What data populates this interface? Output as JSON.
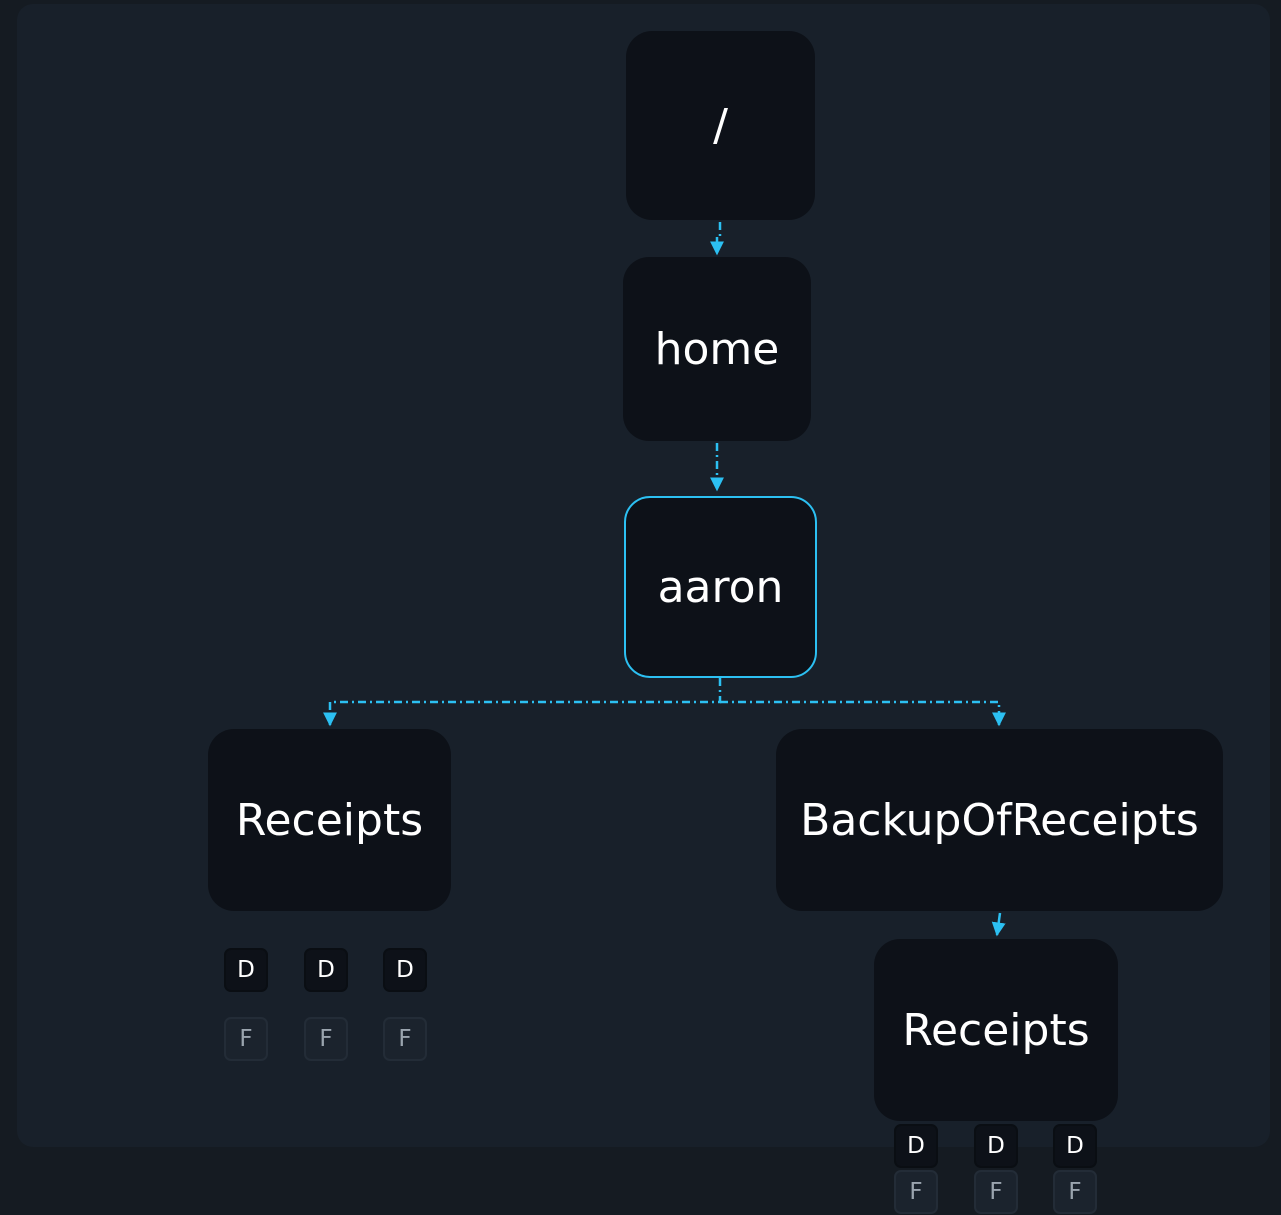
{
  "tree": {
    "root": {
      "label": "/"
    },
    "home": {
      "label": "home"
    },
    "aaron": {
      "label": "aaron",
      "selected": true
    },
    "receipts": {
      "label": "Receipts"
    },
    "backup": {
      "label": "BackupOfReceipts"
    },
    "backup_receipts": {
      "label": "Receipts"
    }
  },
  "receipts_children": {
    "dirs": [
      "D",
      "D",
      "D"
    ],
    "files": [
      "F",
      "F",
      "F"
    ]
  },
  "backup_receipts_children": {
    "dirs": [
      "D",
      "D",
      "D"
    ],
    "files": [
      "F",
      "F",
      "F"
    ]
  },
  "colors": {
    "background": "#151b22",
    "panel": "#18202a",
    "node": "#0d1118",
    "edge": "#2cc0f2"
  }
}
